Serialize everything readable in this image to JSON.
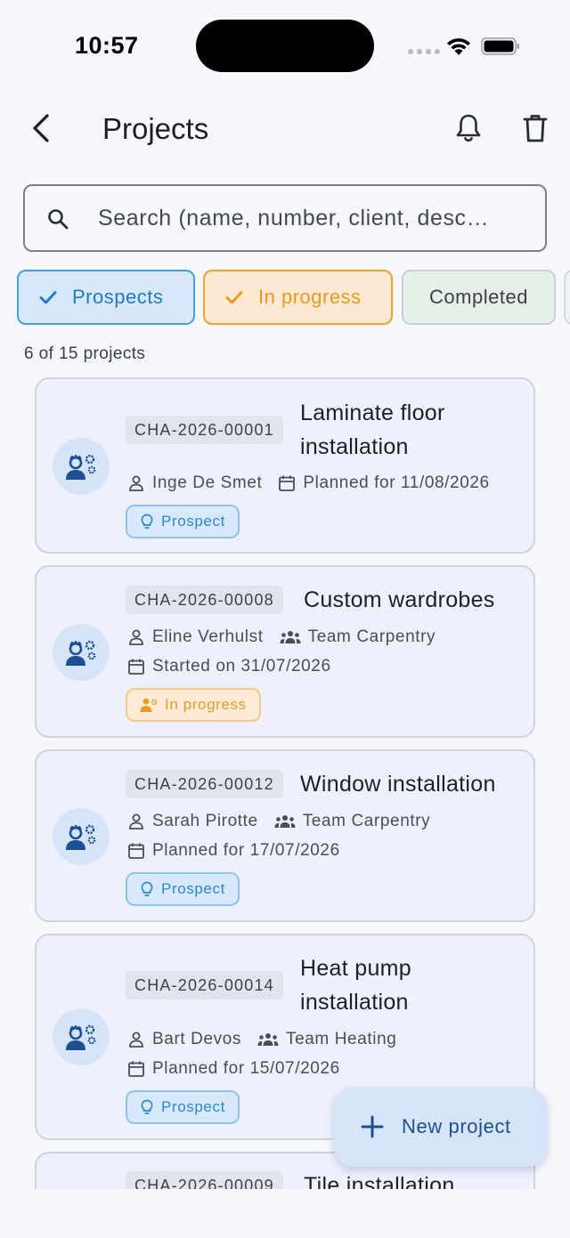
{
  "status_bar": {
    "time": "10:57"
  },
  "header": {
    "title": "Projects"
  },
  "search": {
    "placeholder": "Search (name, number, client, desc…"
  },
  "filters": [
    {
      "label": "Prospects",
      "selected": true,
      "color": "#1e7ac9"
    },
    {
      "label": "In progress",
      "selected": true,
      "color": "#e89920"
    },
    {
      "label": "Completed",
      "selected": false,
      "color": "#3c3f44"
    }
  ],
  "results_count": "6 of 15 projects",
  "projects": [
    {
      "number": "CHA-2026-00001",
      "name_line1": "Laminate floor",
      "name_line2": "installation",
      "client": "Inge De Smet",
      "team": "",
      "date": "Planned for 11/08/2026",
      "status": "Prospect"
    },
    {
      "number": "CHA-2026-00008",
      "name_line1": "Custom wardrobes",
      "name_line2": "",
      "client": "Eline Verhulst",
      "team": "Team Carpentry",
      "date": "Started on 31/07/2026",
      "status": "In progress"
    },
    {
      "number": "CHA-2026-00012",
      "name_line1": "Window installation",
      "name_line2": "",
      "client": "Sarah Pirotte",
      "team": "Team Carpentry",
      "date": "Planned for 17/07/2026",
      "status": "Prospect"
    },
    {
      "number": "CHA-2026-00014",
      "name_line1": "Heat pump",
      "name_line2": "installation",
      "client": "Bart Devos",
      "team": "Team Heating",
      "date": "Planned for 15/07/2026",
      "status": "Prospect"
    },
    {
      "number": "CHA-2026-00009",
      "name_line1": "Tile installation",
      "name_line2": "",
      "client": "",
      "team": "",
      "date": "",
      "status": ""
    }
  ],
  "fab": {
    "label": "New project"
  },
  "colors": {
    "accent": "#1e7ac9",
    "in_progress": "#e89920",
    "fab_bg": "#d6e4fa",
    "fab_text": "#1e4f8f"
  }
}
